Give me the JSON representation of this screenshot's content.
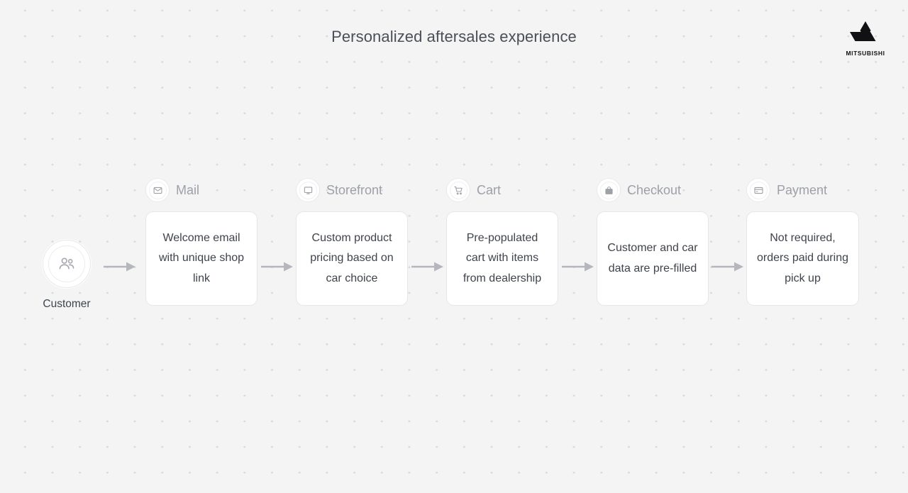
{
  "page": {
    "title": "Personalized aftersales experience",
    "background_color": "#f4f4f5",
    "text_color": "#3f434b",
    "muted_text_color": "#9ea0a8"
  },
  "brand": {
    "name": "MITSUBISHI",
    "logo_icon": "mitsubishi-three-diamonds-icon",
    "logo_color": "#111114"
  },
  "actor": {
    "label": "Customer",
    "icon": "users-icon"
  },
  "steps": [
    {
      "title": "Mail",
      "icon": "envelope-icon",
      "text": "Welcome email with unique shop link"
    },
    {
      "title": "Storefront",
      "icon": "monitor-icon",
      "text": "Custom product pricing based on car choice"
    },
    {
      "title": "Cart",
      "icon": "shopping-cart-icon",
      "text": "Pre-populated cart with items from dealership"
    },
    {
      "title": "Checkout",
      "icon": "shopping-bag-icon",
      "text": "Customer and car data are pre-filled"
    },
    {
      "title": "Payment",
      "icon": "credit-card-icon",
      "text": "Not required, orders paid during pick up"
    }
  ],
  "connectors": {
    "icon": "arrow-right-icon",
    "count": 5,
    "color": "#b6b7bd"
  }
}
